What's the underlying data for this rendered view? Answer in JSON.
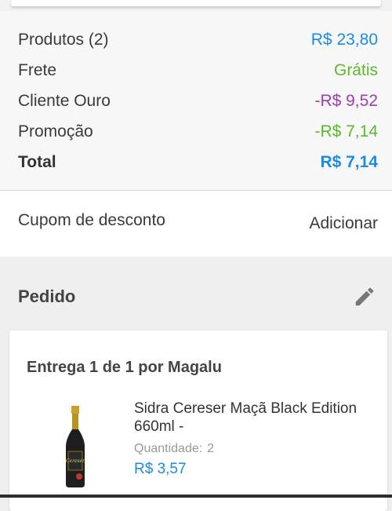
{
  "colors": {
    "blue": "#1a8be8",
    "green": "#5cb82e",
    "purple": "#a13cb5"
  },
  "summary": {
    "rows": [
      {
        "label": "Produtos (2)",
        "value": "R$ 23,80",
        "color": "#1a8be8"
      },
      {
        "label": "Frete",
        "value": "Grátis",
        "color": "#5cb82e"
      },
      {
        "label": "Cliente Ouro",
        "value": "-R$ 9,52",
        "color": "#a13cb5"
      },
      {
        "label": "Promoção",
        "value": "-R$ 7,14",
        "color": "#5cb82e"
      }
    ],
    "total": {
      "label": "Total",
      "value": "R$ 7,14",
      "color": "#1a8be8"
    }
  },
  "coupon": {
    "label": "Cupom de desconto",
    "action": "Adicionar"
  },
  "order": {
    "title": "Pedido",
    "edit_icon": "pencil-icon",
    "delivery": "Entrega 1 de 1 por Magalu",
    "item": {
      "name": "Sidra Cereser Maçã Black Edition 660ml -",
      "quantity_label": "Quantidade:",
      "quantity": "2",
      "price": "R$ 3,57"
    }
  }
}
